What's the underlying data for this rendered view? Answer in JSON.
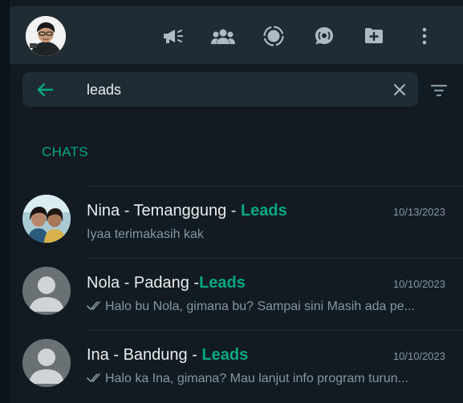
{
  "header": {
    "icons": [
      "megaphone-icon",
      "communities-icon",
      "status-icon",
      "channels-icon",
      "new-chat-icon",
      "menu-icon"
    ]
  },
  "search": {
    "value": "leads",
    "placeholder": "Search"
  },
  "results": {
    "section_label": "CHATS",
    "chats": [
      {
        "name_prefix": "Nina - Temanggung - ",
        "highlight": "Leads",
        "date": "10/13/2023",
        "preview": "Iyaa terimakasih kak",
        "ticks": false,
        "avatar": "photo"
      },
      {
        "name_prefix": "Nola - Padang -",
        "highlight": "Leads",
        "date": "10/10/2023",
        "preview": "Halo bu Nola, gimana bu? Sampai sini Masih ada pe...",
        "ticks": true,
        "avatar": "default"
      },
      {
        "name_prefix": "Ina - Bandung - ",
        "highlight": "Leads",
        "date": "10/10/2023",
        "preview": "Halo ka Ina, gimana? Mau lanjut info program turun...",
        "ticks": true,
        "avatar": "default"
      }
    ]
  },
  "colors": {
    "accent": "#00a884",
    "panel": "#202c33",
    "background": "#111b21",
    "muted_text": "#8696a0"
  }
}
